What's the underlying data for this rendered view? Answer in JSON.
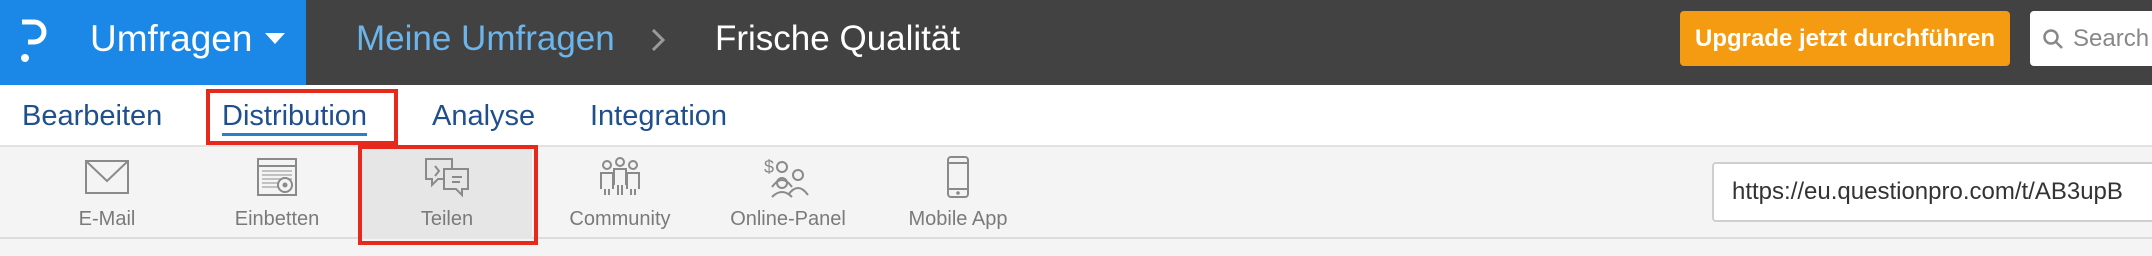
{
  "header": {
    "app_title": "Umfragen",
    "breadcrumb": [
      "Meine Umfragen",
      "Frische Qualität"
    ],
    "upgrade_label": "Upgrade jetzt durchführen",
    "search_placeholder": "Search"
  },
  "nav": {
    "tabs": [
      {
        "label": "Bearbeiten",
        "active": false
      },
      {
        "label": "Distribution",
        "active": true
      },
      {
        "label": "Analyse",
        "active": false
      },
      {
        "label": "Integration",
        "active": false
      }
    ]
  },
  "toolbar": {
    "items": [
      {
        "label": "E-Mail",
        "icon": "envelope-icon"
      },
      {
        "label": "Einbetten",
        "icon": "embed-icon"
      },
      {
        "label": "Teilen",
        "icon": "share-icon",
        "selected": true
      },
      {
        "label": "Community",
        "icon": "community-icon"
      },
      {
        "label": "Online-Panel",
        "icon": "online-panel-icon"
      },
      {
        "label": "Mobile App",
        "icon": "mobile-app-icon"
      }
    ],
    "survey_url": "https://eu.questionpro.com/t/AB3upB"
  },
  "colors": {
    "brand_blue": "#1b87e6",
    "topbar_dark": "#424242",
    "upgrade_orange": "#f59b12",
    "nav_text": "#1f4f8c",
    "highlight_red": "#e5291d"
  }
}
